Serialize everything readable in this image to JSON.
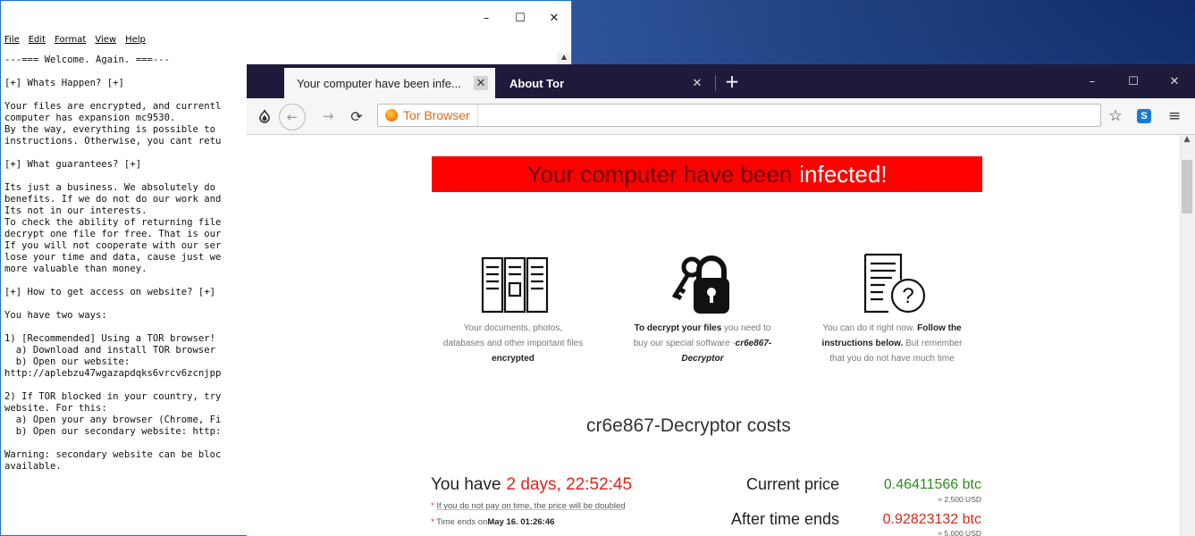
{
  "notepad": {
    "menu": [
      "File",
      "Edit",
      "Format",
      "View",
      "Help"
    ],
    "controls": {
      "minimize": "–",
      "maximize": "☐",
      "close": "✕"
    },
    "lines": [
      "---=== Welcome. Again. ===---",
      "",
      "[+] Whats Happen? [+]",
      "",
      "Your files are encrypted, and currentl",
      "computer has expansion mc9530.",
      "By the way, everything is possible to",
      "instructions. Otherwise, you cant retu",
      "",
      "[+] What guarantees? [+]",
      "",
      "Its just a business. We absolutely do",
      "benefits. If we do not do our work and",
      "Its not in our interests.",
      "To check the ability of returning file",
      "decrypt one file for free. That is our",
      "If you will not cooperate with our ser",
      "lose your time and data, cause just we",
      "more valuable than money.",
      "",
      "[+] How to get access on website? [+]",
      "",
      "You have two ways:",
      "",
      "1) [Recommended] Using a TOR browser!",
      "  a) Download and install TOR browser",
      "  b) Open our website:",
      "http://aplebzu47wgazapdqks6vrcv6zcnjpp",
      "",
      "2) If TOR blocked in your country, try",
      "website. For this:",
      "  a) Open your any browser (Chrome, Fi",
      "  b) Open our secondary website: http:",
      "",
      "Warning: secondary website can be bloc",
      "available."
    ]
  },
  "browser": {
    "tabs": [
      {
        "label": "Your computer have been infe...",
        "active": true
      },
      {
        "label": "About Tor",
        "active": false
      }
    ],
    "new_tab": "+",
    "window_controls": {
      "minimize": "–",
      "maximize": "☐",
      "close": "✕"
    },
    "address_label": "Tor Browser"
  },
  "page": {
    "banner_main": "Your computer have been",
    "banner_highlight": "infected",
    "banner_end": "!",
    "features": [
      {
        "icon": "files-icon",
        "line1": "Your documents, photos,",
        "line2": "databases and other important files",
        "line3": "encrypted"
      },
      {
        "icon": "key-lock-icon",
        "bold1": "To decrypt your files",
        "text1": " you need to",
        "line2": "buy our special software -",
        "italic1": "cr6e867-",
        "italic2": "Decryptor"
      },
      {
        "icon": "document-question-icon",
        "text1": "You can do it right now.",
        "bold1": " Follow the",
        "bold2": "instructions below.",
        "text2": " But remember",
        "line3": "that you do not have much time"
      }
    ],
    "costs_title": "cr6e867-Decryptor costs",
    "you_have": "You have",
    "countdown": "2 days, 22:52:45",
    "note1_text": "If you do not pay on time, the price will be doubled",
    "note2_text": "Time ends on",
    "note2_date": "May 16. 01:26:46",
    "current_price_label": "Current price",
    "current_price": "0.46411566 btc",
    "current_usd": "≈ 2,500 USD",
    "after_label": "After time ends",
    "after_price": "0.92823132 btc",
    "after_usd": "≈ 5,000 USD",
    "colors": {
      "banner": "#ff0000",
      "price_green": "#2e8b1e",
      "price_red": "#e2231a"
    }
  }
}
